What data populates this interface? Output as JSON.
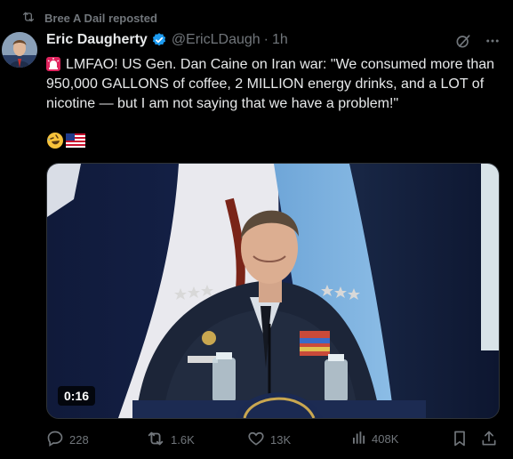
{
  "repost": {
    "label": "Bree A Dail reposted"
  },
  "author": {
    "name": "Eric Daugherty",
    "handle": "@EricLDaugh",
    "separator": "·",
    "time": "1h"
  },
  "tweet": {
    "text": "LMFAO! US Gen. Dan Caine on Iran war: \"We consumed more than 950,000 GALLONS of coffee, 2 MILLION energy drinks, and a LOT of nicotine — but I am not saying that we have a problem!\"",
    "emojis": [
      "rolling-on-floor-laughing-emoji",
      "us-flag-emoji"
    ]
  },
  "media": {
    "duration": "0:16"
  },
  "actions": {
    "replies": "228",
    "reposts": "1.6K",
    "likes": "13K",
    "views": "408K"
  },
  "colors": {
    "background": "#000000",
    "text": "#e7e9ea",
    "muted": "#71767b",
    "verified": "#1d9bf0"
  },
  "icons": [
    "repost-icon",
    "verified-icon",
    "grok-icon",
    "more-icon",
    "siren-icon",
    "reply-icon",
    "like-icon",
    "views-icon",
    "bookmark-icon",
    "share-icon"
  ]
}
